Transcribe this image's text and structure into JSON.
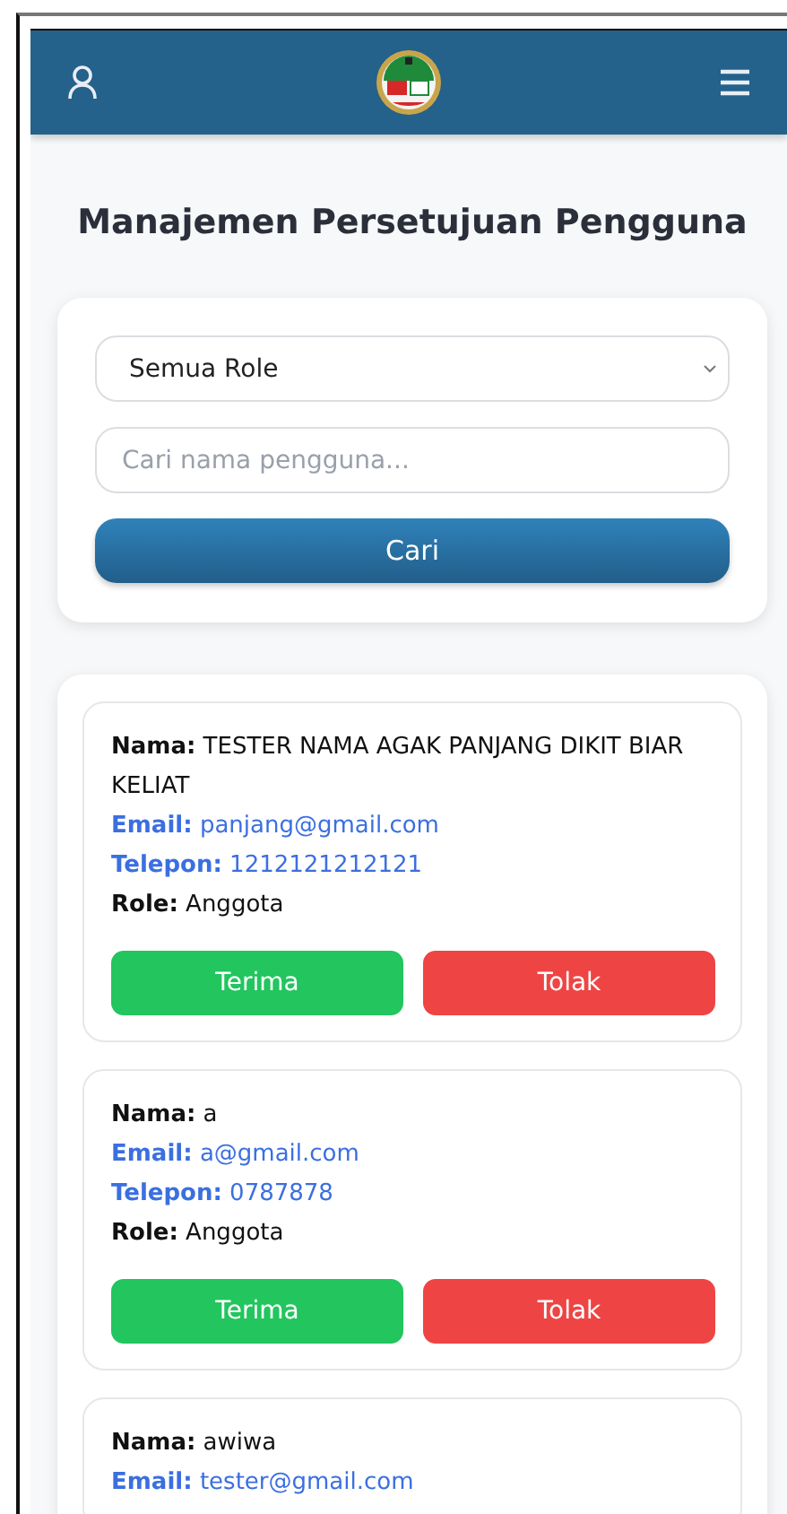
{
  "header": {
    "title": "Manajemen Persetujuan Pengguna"
  },
  "filter": {
    "role_select": "Semua Role",
    "search": {
      "placeholder": "Cari nama pengguna..."
    },
    "button": "Cari"
  },
  "users": [
    {
      "fields": [
        {
          "kind": "text",
          "text": "**Nama:** TESTER NAMA AGAK PANJANG DIKIT BIAR KELIAT"
        },
        {
          "kind": "link",
          "text": "**Email:** panjang@gmail.com"
        },
        {
          "kind": "link",
          "text": "**Telepon:** 1212121212121"
        },
        {
          "kind": "text",
          "text": "**Role:** Anggota"
        }
      ],
      "actions": [
        "Terima",
        "Tolak"
      ]
    },
    {
      "fields": [
        {
          "kind": "text",
          "text": "**Nama:** a"
        },
        {
          "kind": "link",
          "text": "**Email:** a@gmail.com"
        },
        {
          "kind": "link",
          "text": "**Telepon:** 0787878"
        },
        {
          "kind": "text",
          "text": "**Role:** Anggota"
        }
      ],
      "actions": [
        "Terima",
        "Tolak"
      ]
    },
    {
      "fields": [
        {
          "kind": "text",
          "text": "**Nama:** awiwa"
        },
        {
          "kind": "link",
          "text": "**Email:** tester@gmail.com"
        }
      ]
    }
  ]
}
